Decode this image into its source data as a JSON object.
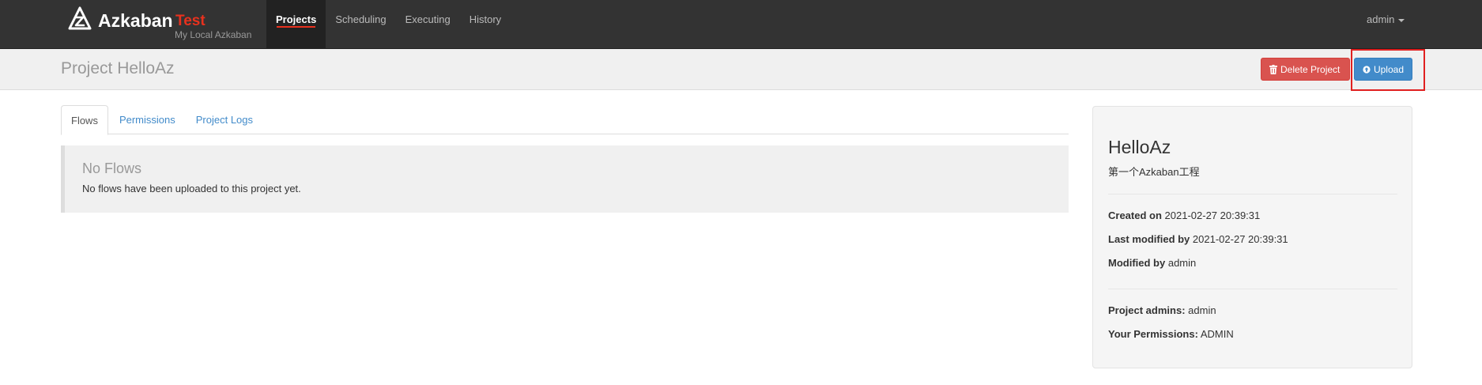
{
  "navbar": {
    "brand_name": "Azkaban",
    "brand_env": "Test",
    "brand_subtitle": "My Local Azkaban",
    "nav_items": [
      {
        "label": "Projects",
        "active": true
      },
      {
        "label": "Scheduling",
        "active": false
      },
      {
        "label": "Executing",
        "active": false
      },
      {
        "label": "History",
        "active": false
      }
    ],
    "user": "admin"
  },
  "header": {
    "title": "Project HelloAz",
    "delete_label": "Delete Project",
    "upload_label": "Upload"
  },
  "tabs": [
    {
      "label": "Flows",
      "active": true
    },
    {
      "label": "Permissions",
      "active": false
    },
    {
      "label": "Project Logs",
      "active": false
    }
  ],
  "alert": {
    "title": "No Flows",
    "text": "No flows have been uploaded to this project yet."
  },
  "info": {
    "name": "HelloAz",
    "description": "第一个Azkaban工程",
    "created_on_label": "Created on",
    "created_on": "2021-02-27 20:39:31",
    "last_modified_label": "Last modified by",
    "last_modified": "2021-02-27 20:39:31",
    "modified_by_label": "Modified by",
    "modified_by": "admin",
    "admins_label": "Project admins:",
    "admins": "admin",
    "permissions_label": "Your Permissions:",
    "permissions": "ADMIN"
  },
  "icons": {
    "logo": "azkaban-logo-icon",
    "delete": "trash-icon",
    "upload": "upload-circle-icon",
    "user_caret": "caret-down-icon"
  },
  "colors": {
    "navbar_bg": "#333333",
    "brand_env": "#e8311e",
    "danger": "#d9534f",
    "primary": "#428bca",
    "link": "#428bca",
    "highlight": "#e02020"
  }
}
